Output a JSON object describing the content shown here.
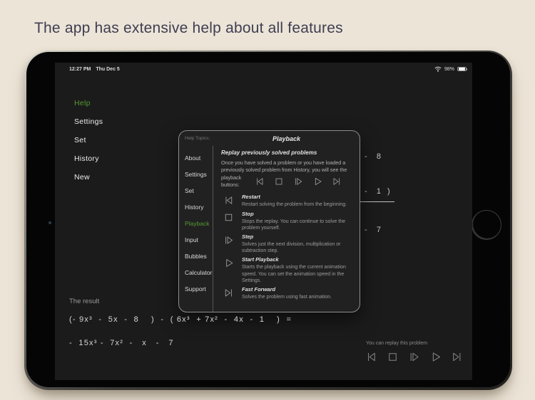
{
  "page": {
    "title": "The app has extensive help about all features"
  },
  "status_bar": {
    "time": "12:27 PM",
    "date": "Thu Dec 5",
    "battery_percent": "98%"
  },
  "menu": {
    "items": [
      {
        "label": "Help",
        "active": true
      },
      {
        "label": "Settings",
        "active": false
      },
      {
        "label": "Set",
        "active": false
      },
      {
        "label": "History",
        "active": false
      },
      {
        "label": "New",
        "active": false
      }
    ]
  },
  "background_problem": {
    "line1": "-   8",
    "line2": "-   1  )",
    "line3": "-   7"
  },
  "help_dialog": {
    "header_label": "Help Topics:",
    "title": "Playback",
    "topics": [
      {
        "label": "About",
        "active": false
      },
      {
        "label": "Settings",
        "active": false
      },
      {
        "label": "Set",
        "active": false
      },
      {
        "label": "History",
        "active": false
      },
      {
        "label": "Playback",
        "active": true
      },
      {
        "label": "Input",
        "active": false
      },
      {
        "label": "Bubbles",
        "active": false
      },
      {
        "label": "Calculator",
        "active": false
      },
      {
        "label": "Support",
        "active": false
      }
    ],
    "subtitle": "Replay previously solved problems",
    "intro_text": "Once you have solved a problem or you have loaded a previously solved problem from History, you will see the",
    "intro_buttons_label": "playback buttons:",
    "buttons": [
      {
        "icon": "restart-icon",
        "name": "Restart",
        "description": "Restart solving the problem from the beginning."
      },
      {
        "icon": "stop-icon",
        "name": "Stop",
        "description": "Stops the replay. You can continue to solve the problem yourself."
      },
      {
        "icon": "step-icon",
        "name": "Step",
        "description": "Solves just the next division, multiplication or subtraction step."
      },
      {
        "icon": "start-playback-icon",
        "name": "Start Playback",
        "description": "Starts the playback using the current animation speed. You can set the animation speed in the Settings."
      },
      {
        "icon": "fast-forward-icon",
        "name": "Fast Forward",
        "description": "Solves the problem using fast animation."
      }
    ]
  },
  "result": {
    "label": "The result",
    "problem": "(- 9x³  -  5x  -  8    )  -  ( 6x³  + 7x²  -  4x  -  1    )  =",
    "answer": "-  15x³ -  7x²  -   x   -   7"
  },
  "replay": {
    "hint": "You can replay this problem"
  },
  "colors": {
    "accent_green": "#559a31",
    "screen_bg": "#1b1b1b",
    "page_bg": "#ece4d7",
    "dialog_bg": "#212121"
  }
}
